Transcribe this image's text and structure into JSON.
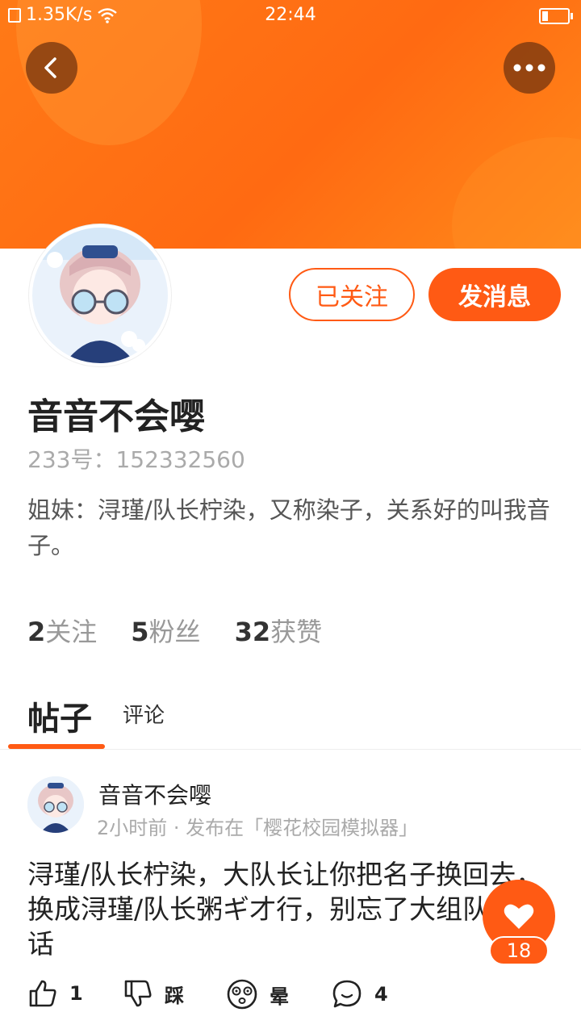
{
  "status_bar": {
    "network_speed": "1.35K/s",
    "time": "22:44",
    "battery_level": 0.25
  },
  "header": {
    "back_icon": "chevron-left-icon",
    "more_icon": "more-dots-icon"
  },
  "profile": {
    "follow_button": "已关注",
    "message_button": "发消息",
    "username": "音音不会嘤",
    "uid": "233号：152332560",
    "bio": "姐妹：浔瑾/队长柠染，又称染子，关系好的叫我音子。",
    "stats": {
      "following_count": "2",
      "following_label": "关注",
      "followers_count": "5",
      "followers_label": "粉丝",
      "likes_count": "32",
      "likes_label": "获赞"
    }
  },
  "tabs": [
    {
      "label": "帖子",
      "active": true
    },
    {
      "label": "评论",
      "active": false
    }
  ],
  "post": {
    "author": "音音不会嘤",
    "meta": "2小时前 · 发布在「樱花校园模拟器」",
    "text": "浔瑾/队长柠染，大队长让你把名子换回去，换成浔瑾/队长粥ギ才行，别忘了大组队长的话",
    "actions": {
      "like_count": "1",
      "dislike_label": "踩",
      "dizzy_label": "晕",
      "comment_count": "4"
    }
  },
  "fab": {
    "heart_count": "18"
  },
  "colors": {
    "accent": "#ff5a14",
    "banner": "#ff7a17"
  }
}
